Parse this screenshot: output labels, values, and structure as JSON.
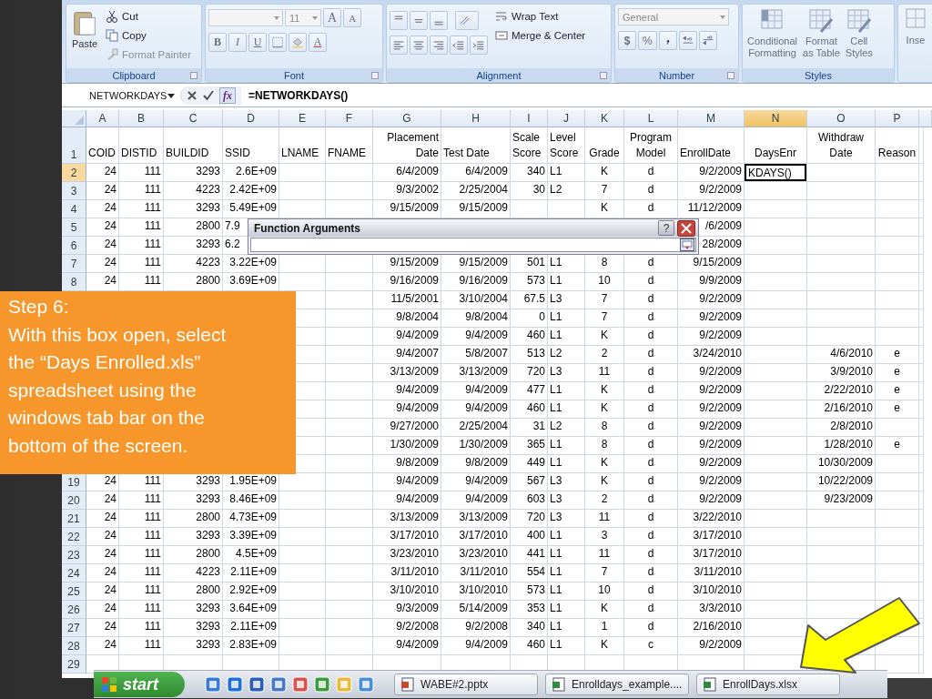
{
  "ribbon": {
    "clipboard": {
      "label": "Clipboard",
      "paste": "Paste",
      "cut": "Cut",
      "copy": "Copy",
      "format_painter": "Format Painter"
    },
    "font": {
      "label": "Font",
      "size": "11",
      "grow": "A",
      "shrink": "A",
      "bold": "B",
      "italic": "I",
      "underline": "U",
      "font_color": "A"
    },
    "alignment": {
      "label": "Alignment",
      "wrap": "Wrap Text",
      "merge": "Merge & Center"
    },
    "number": {
      "label": "Number",
      "format": "General",
      "currency": "$",
      "percent": "%"
    },
    "styles": {
      "label": "Styles",
      "buttons": [
        "Conditional\nFormatting",
        "Format\nas Table",
        "Cell\nStyles"
      ]
    },
    "cells": {
      "insert": "Inse"
    }
  },
  "formula_bar": {
    "name_box": "NETWORKDAYS",
    "fx": "fx",
    "formula": "=NETWORKDAYS()"
  },
  "sheet": {
    "columns": [
      {
        "label": "A",
        "selected": false
      },
      {
        "label": "B",
        "selected": false
      },
      {
        "label": "C",
        "selected": false
      },
      {
        "label": "D",
        "selected": false
      },
      {
        "label": "E",
        "selected": false
      },
      {
        "label": "F",
        "selected": false
      },
      {
        "label": "G",
        "selected": false
      },
      {
        "label": "H",
        "selected": false
      },
      {
        "label": "I",
        "selected": false
      },
      {
        "label": "J",
        "selected": false
      },
      {
        "label": "K",
        "selected": false
      },
      {
        "label": "L",
        "selected": false
      },
      {
        "label": "M",
        "selected": false
      },
      {
        "label": "N",
        "selected": true
      },
      {
        "label": "O",
        "selected": false
      },
      {
        "label": "P",
        "selected": false
      }
    ],
    "rows": [
      {
        "kind": "header",
        "row": "1",
        "selected": false,
        "cells": {
          "A": "COID",
          "B": "DISTID",
          "C": "BUILDID",
          "D": "SSID",
          "E": "LNAME",
          "F": "FNAME",
          "G": "Placement\nDate",
          "H": "\nTest Date",
          "I": "Scale\nScore",
          "J": "Level\nScore",
          "K": "Grade",
          "L": "Program\nModel",
          "M": "EnrollDate",
          "N": "DaysEnr",
          "O": "Withdraw\nDate",
          "P": "Reason"
        }
      },
      {
        "kind": "data",
        "row": "2",
        "selected": true,
        "cells": {
          "A": "24",
          "B": "111",
          "C": "3293",
          "D": "2.6E+09",
          "G": "6/4/2009",
          "H": "6/4/2009",
          "I": "340",
          "J": "L1",
          "K": "K",
          "L": "d",
          "M": "9/2/2009",
          "N": "KDAYS()"
        }
      },
      {
        "kind": "data",
        "row": "3",
        "selected": false,
        "cells": {
          "A": "24",
          "B": "111",
          "C": "4223",
          "D": "2.42E+09",
          "G": "9/3/2002",
          "H": "2/25/2004",
          "I": "30",
          "J": "L2",
          "K": "7",
          "L": "d",
          "M": "9/2/2009"
        }
      },
      {
        "kind": "data",
        "row": "4",
        "selected": false,
        "cells": {
          "A": "24",
          "B": "111",
          "C": "3293",
          "D": "5.49E+09",
          "G": "9/15/2009",
          "H": "9/15/2009",
          "K": "K",
          "L": "d",
          "M": "11/12/2009"
        }
      },
      {
        "kind": "data",
        "row": "5",
        "selected": false,
        "covered": true,
        "cells": {
          "A": "24",
          "B": "111",
          "C": "2800",
          "D": "7.9",
          "M": "/6/2009"
        }
      },
      {
        "kind": "data",
        "row": "6",
        "selected": false,
        "covered": true,
        "cells": {
          "A": "24",
          "B": "111",
          "C": "3293",
          "D": "6.2",
          "M": "28/2009"
        }
      },
      {
        "kind": "data",
        "row": "7",
        "selected": false,
        "cells": {
          "A": "24",
          "B": "111",
          "C": "4223",
          "D": "3.22E+09",
          "G": "9/15/2009",
          "H": "9/15/2009",
          "I": "501",
          "J": "L1",
          "K": "8",
          "L": "d",
          "M": "9/15/2009"
        }
      },
      {
        "kind": "data",
        "row": "8",
        "selected": false,
        "cells": {
          "A": "24",
          "B": "111",
          "C": "2800",
          "D": "3.69E+09",
          "G": "9/16/2009",
          "H": "9/16/2009",
          "I": "573",
          "J": "L1",
          "K": "10",
          "L": "d",
          "M": "9/9/2009"
        }
      },
      {
        "kind": "data",
        "cells": {
          "G": "11/5/2001",
          "H": "3/10/2004",
          "I": "67.5",
          "J": "L3",
          "K": "7",
          "L": "d",
          "M": "9/2/2009"
        }
      },
      {
        "kind": "data",
        "cells": {
          "G": "9/8/2004",
          "H": "9/8/2004",
          "I": "0",
          "J": "L1",
          "K": "7",
          "L": "d",
          "M": "9/2/2009"
        }
      },
      {
        "kind": "data",
        "cells": {
          "G": "9/4/2009",
          "H": "9/4/2009",
          "I": "460",
          "J": "L1",
          "K": "K",
          "L": "d",
          "M": "9/2/2009"
        }
      },
      {
        "kind": "data",
        "cells": {
          "G": "9/4/2007",
          "H": "5/8/2007",
          "I": "513",
          "J": "L2",
          "K": "2",
          "L": "d",
          "M": "3/24/2010",
          "O": "4/6/2010",
          "P": "e"
        }
      },
      {
        "kind": "data",
        "cells": {
          "G": "3/13/2009",
          "H": "3/13/2009",
          "I": "720",
          "J": "L3",
          "K": "11",
          "L": "d",
          "M": "9/2/2009",
          "O": "3/9/2010",
          "P": "e"
        }
      },
      {
        "kind": "data",
        "cells": {
          "G": "9/4/2009",
          "H": "9/4/2009",
          "I": "477",
          "J": "L1",
          "K": "K",
          "L": "d",
          "M": "9/2/2009",
          "O": "2/22/2010",
          "P": "e"
        }
      },
      {
        "kind": "data",
        "cells": {
          "G": "9/4/2009",
          "H": "9/4/2009",
          "I": "460",
          "J": "L1",
          "K": "K",
          "L": "d",
          "M": "9/2/2009",
          "O": "2/16/2010",
          "P": "e"
        }
      },
      {
        "kind": "data",
        "cells": {
          "G": "9/27/2000",
          "H": "2/25/2004",
          "I": "31",
          "J": "L2",
          "K": "8",
          "L": "d",
          "M": "9/2/2009",
          "O": "2/8/2010"
        }
      },
      {
        "kind": "data",
        "cells": {
          "G": "1/30/2009",
          "H": "1/30/2009",
          "I": "365",
          "J": "L1",
          "K": "8",
          "L": "d",
          "M": "9/2/2009",
          "O": "1/28/2010",
          "P": "e"
        }
      },
      {
        "kind": "data",
        "cells": {
          "G": "9/8/2009",
          "H": "9/8/2009",
          "I": "449",
          "J": "L1",
          "K": "K",
          "L": "d",
          "M": "9/2/2009",
          "O": "10/30/2009"
        }
      },
      {
        "kind": "data",
        "row": "19",
        "selected": false,
        "cells": {
          "A": "24",
          "B": "111",
          "C": "3293",
          "D": "1.95E+09",
          "G": "9/4/2009",
          "H": "9/4/2009",
          "I": "567",
          "J": "L3",
          "K": "K",
          "L": "d",
          "M": "9/2/2009",
          "O": "10/22/2009"
        }
      },
      {
        "kind": "data",
        "row": "20",
        "selected": false,
        "cells": {
          "A": "24",
          "B": "111",
          "C": "3293",
          "D": "8.46E+09",
          "G": "9/4/2009",
          "H": "9/4/2009",
          "I": "603",
          "J": "L3",
          "K": "2",
          "L": "d",
          "M": "9/2/2009",
          "O": "9/23/2009"
        }
      },
      {
        "kind": "data",
        "row": "21",
        "selected": false,
        "cells": {
          "A": "24",
          "B": "111",
          "C": "2800",
          "D": "4.73E+09",
          "G": "3/13/2009",
          "H": "3/13/2009",
          "I": "720",
          "J": "L3",
          "K": "11",
          "L": "d",
          "M": "3/22/2010"
        }
      },
      {
        "kind": "data",
        "row": "22",
        "selected": false,
        "cells": {
          "A": "24",
          "B": "111",
          "C": "3293",
          "D": "3.39E+09",
          "G": "3/17/2010",
          "H": "3/17/2010",
          "I": "400",
          "J": "L1",
          "K": "3",
          "L": "d",
          "M": "3/17/2010"
        }
      },
      {
        "kind": "data",
        "row": "23",
        "selected": false,
        "cells": {
          "A": "24",
          "B": "111",
          "C": "2800",
          "D": "4.5E+09",
          "G": "3/23/2010",
          "H": "3/23/2010",
          "I": "441",
          "J": "L1",
          "K": "11",
          "L": "d",
          "M": "3/17/2010"
        }
      },
      {
        "kind": "data",
        "row": "24",
        "selected": false,
        "cells": {
          "A": "24",
          "B": "111",
          "C": "4223",
          "D": "2.11E+09",
          "G": "3/11/2010",
          "H": "3/11/2010",
          "I": "554",
          "J": "L1",
          "K": "7",
          "L": "d",
          "M": "3/11/2010"
        }
      },
      {
        "kind": "data",
        "row": "25",
        "selected": false,
        "cells": {
          "A": "24",
          "B": "111",
          "C": "2800",
          "D": "2.92E+09",
          "G": "3/10/2010",
          "H": "3/10/2010",
          "I": "573",
          "J": "L1",
          "K": "10",
          "L": "d",
          "M": "3/10/2010"
        }
      },
      {
        "kind": "data",
        "row": "26",
        "selected": false,
        "cells": {
          "A": "24",
          "B": "111",
          "C": "3293",
          "D": "3.64E+09",
          "G": "9/3/2009",
          "H": "5/14/2009",
          "I": "353",
          "J": "L1",
          "K": "K",
          "L": "d",
          "M": "3/3/2010"
        }
      },
      {
        "kind": "data",
        "row": "27",
        "selected": false,
        "cells": {
          "A": "24",
          "B": "111",
          "C": "3293",
          "D": "2.11E+09",
          "G": "9/2/2008",
          "H": "9/2/2008",
          "I": "340",
          "J": "L1",
          "K": "1",
          "L": "d",
          "M": "2/16/2010"
        }
      },
      {
        "kind": "data",
        "row": "28",
        "selected": false,
        "cells": {
          "A": "24",
          "B": "111",
          "C": "3293",
          "D": "2.83E+09",
          "G": "9/4/2009",
          "H": "9/4/2009",
          "I": "460",
          "J": "L1",
          "K": "K",
          "L": "c",
          "M": "9/2/2009"
        }
      },
      {
        "kind": "data",
        "row": "29",
        "selected": false
      }
    ]
  },
  "dialog": {
    "title": "Function Arguments",
    "help": "?"
  },
  "callout": {
    "title": "Step 6:",
    "text": "With this box open, select the “Days Enrolled.xls” spreadsheet using the windows tab bar on the bottom of the screen."
  },
  "taskbar": {
    "start": "start",
    "tasks": [
      "WABE#2.pptx",
      "Enrolldays_example....",
      "EnrollDays.xlsx"
    ]
  }
}
